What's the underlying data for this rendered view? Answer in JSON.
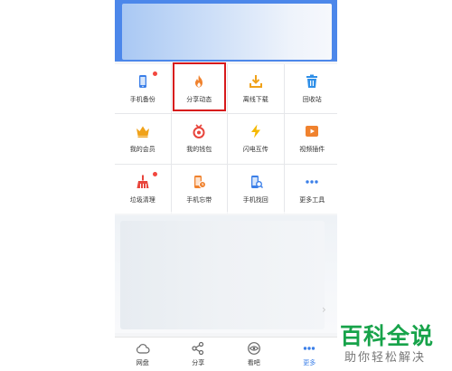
{
  "grid": [
    {
      "label": "手机备份",
      "icon": "phone-backup-icon",
      "badge": true
    },
    {
      "label": "分享动态",
      "icon": "flame-icon",
      "badge": false,
      "highlighted": true
    },
    {
      "label": "离线下载",
      "icon": "download-icon",
      "badge": false
    },
    {
      "label": "回收站",
      "icon": "trash-icon",
      "badge": false
    },
    {
      "label": "我的会员",
      "icon": "crown-icon",
      "badge": false
    },
    {
      "label": "我的钱包",
      "icon": "wallet-icon",
      "badge": false
    },
    {
      "label": "闪电互传",
      "icon": "lightning-icon",
      "badge": false
    },
    {
      "label": "视频插件",
      "icon": "video-icon",
      "badge": false
    },
    {
      "label": "垃圾清理",
      "icon": "broom-icon",
      "badge": true
    },
    {
      "label": "手机忘带",
      "icon": "phone-forgot-icon",
      "badge": false
    },
    {
      "label": "手机找回",
      "icon": "phone-find-icon",
      "badge": false
    },
    {
      "label": "更多工具",
      "icon": "more-dots-icon",
      "badge": false
    }
  ],
  "tabbar": [
    {
      "label": "网盘",
      "icon": "cloud-icon",
      "active": false
    },
    {
      "label": "分享",
      "icon": "share-icon",
      "active": false
    },
    {
      "label": "看吧",
      "icon": "eye-icon",
      "active": false
    },
    {
      "label": "更多",
      "icon": "more-dots-icon",
      "active": true
    }
  ],
  "watermark": {
    "title": "百科全说",
    "subtitle": "助你轻松解决"
  },
  "colors": {
    "accent": "#3b7fe8",
    "banner": "#4c87ea",
    "highlight": "#d7191b",
    "watermark": "#17a34a",
    "badge": "#f2473e"
  }
}
